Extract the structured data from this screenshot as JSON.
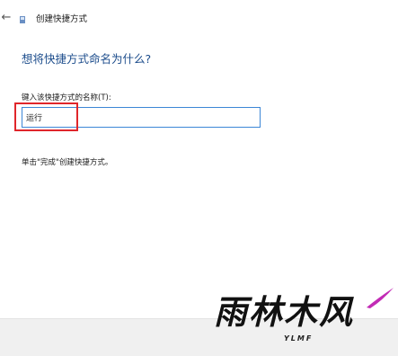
{
  "window": {
    "back_glyph": "←",
    "icon": "shortcut-icon",
    "title": "创建快捷方式"
  },
  "main": {
    "heading": "想将快捷方式命名为什么?",
    "field_label": "键入该快捷方式的名称(T):",
    "name_value": "运行",
    "hint": "单击\"完成\"创建快捷方式。"
  },
  "watermark": {
    "text": "雨林木风",
    "sub": "YLMF"
  },
  "colors": {
    "heading": "#1d4d8c",
    "input_border": "#3c86d6",
    "highlight": "#e0262b",
    "footer_bg": "#f0f0f0"
  }
}
